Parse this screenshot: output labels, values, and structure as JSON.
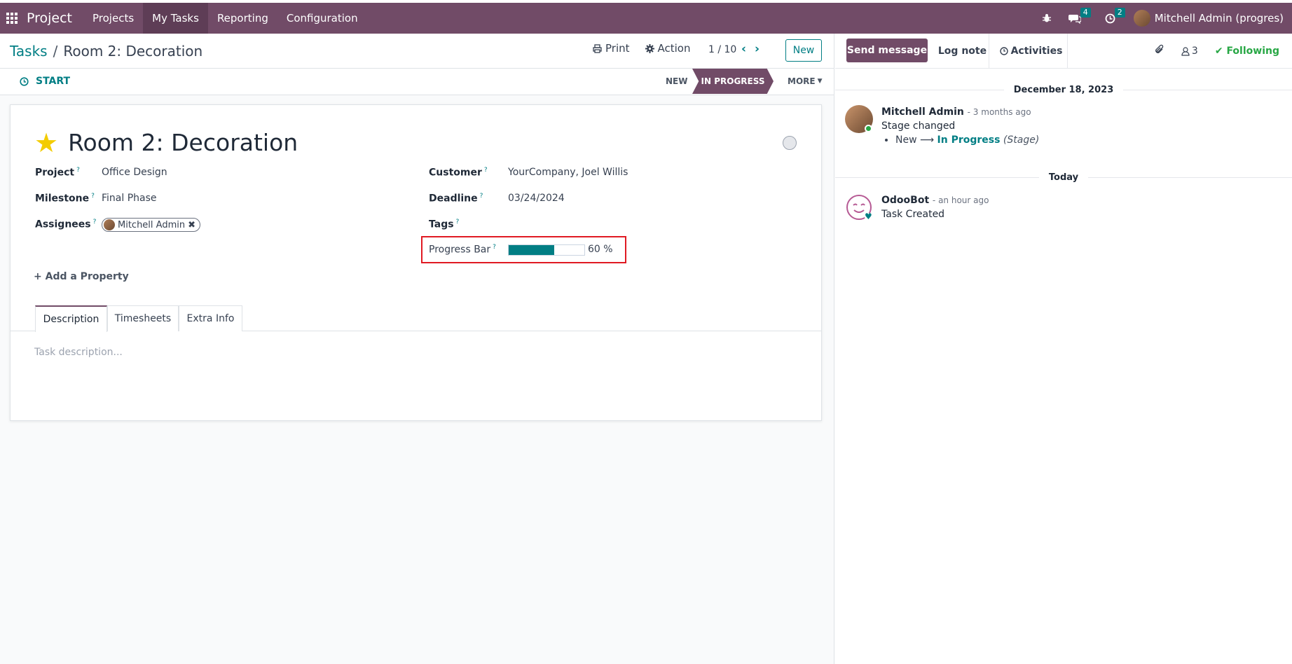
{
  "topbar": {
    "app_name": "Project",
    "menus": [
      "Projects",
      "My Tasks",
      "Reporting",
      "Configuration"
    ],
    "messages_badge": "4",
    "activities_badge": "2",
    "user_name": "Mitchell Admin (progres)"
  },
  "control": {
    "breadcrumb_parent": "Tasks",
    "breadcrumb_sep": "/",
    "breadcrumb_current": "Room 2: Decoration",
    "print_label": "Print",
    "action_label": "Action",
    "pager": "1 / 10",
    "new_label": "New"
  },
  "statusbar": {
    "start_label": "START",
    "stages": [
      "NEW",
      "IN PROGRESS",
      "MORE"
    ],
    "active_stage": "IN PROGRESS"
  },
  "task": {
    "title": "Room 2: Decoration",
    "fields": {
      "project_label": "Project",
      "project_value": "Office Design",
      "milestone_label": "Milestone",
      "milestone_value": "Final Phase",
      "assignees_label": "Assignees",
      "assignee": "Mitchell Admin",
      "customer_label": "Customer",
      "customer_value": "YourCompany, Joel Willis",
      "deadline_label": "Deadline",
      "deadline_value": "03/24/2024",
      "tags_label": "Tags",
      "progress_label": "Progress Bar",
      "progress_value": 0.6,
      "progress_text": "60 %",
      "help_mark": "?"
    },
    "add_property": "Add a Property",
    "tabs": [
      "Description",
      "Timesheets",
      "Extra Info"
    ],
    "description_placeholder": "Task description..."
  },
  "chatter": {
    "send_message": "Send message",
    "log_note": "Log note",
    "activities": "Activities",
    "followers_count": "3",
    "following": "Following",
    "date1": "December 18, 2023",
    "msg1": {
      "author": "Mitchell Admin",
      "time": "- 3 months ago",
      "text": "Stage changed",
      "from": "New",
      "arrow": "⟶",
      "to": "In Progress",
      "field": "(Stage)"
    },
    "date2": "Today",
    "msg2": {
      "author": "OdooBot",
      "time": "- an hour ago",
      "text": "Task Created"
    }
  },
  "colors": {
    "brand": "#714b67",
    "accent": "#017e84",
    "highlight_box": "#e01a23",
    "star": "#f3cc00",
    "following": "#28a745"
  }
}
